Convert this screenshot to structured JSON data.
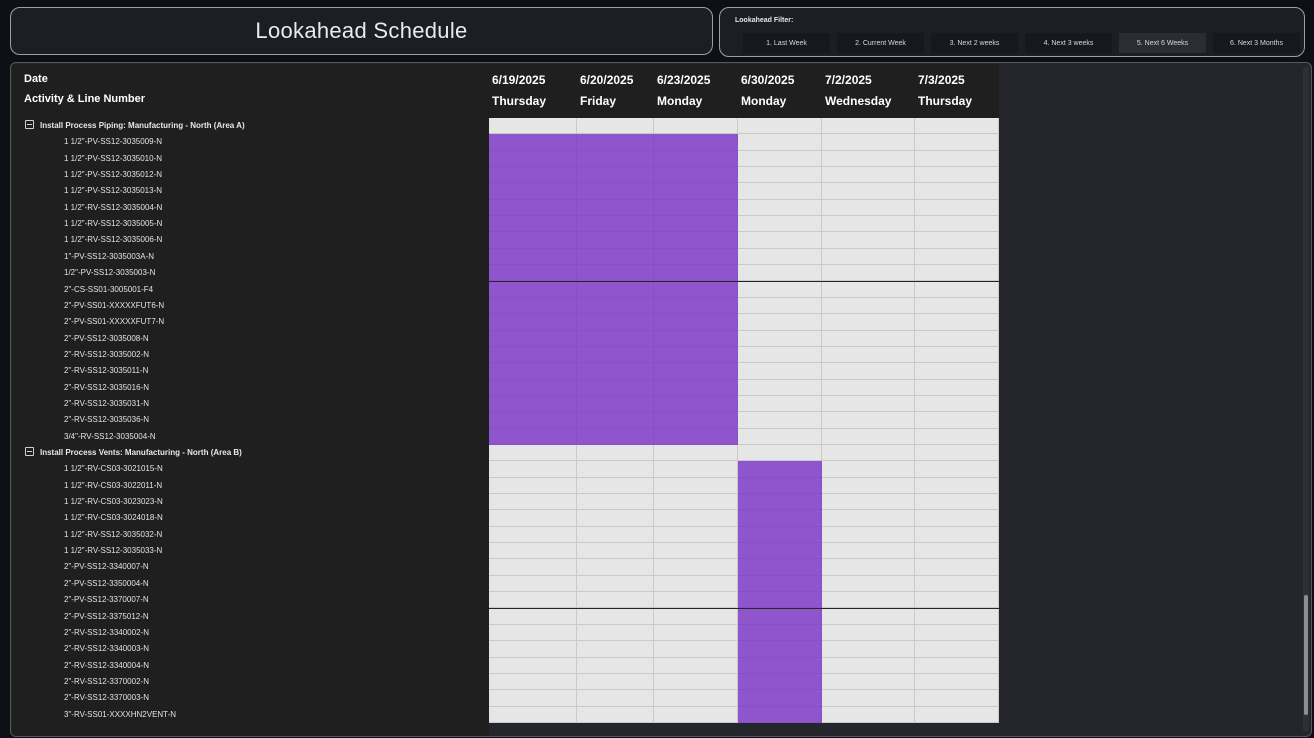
{
  "header": {
    "title": "Lookahead Schedule"
  },
  "filter": {
    "label": "Lookahead Filter:",
    "options": [
      "1. Last Week",
      "2. Current Week",
      "3. Next 2 weeks",
      "4. Next 3 weeks",
      "5. Next 6 Weeks",
      "6. Next 3 Months"
    ],
    "selected": "5. Next 6 Weeks"
  },
  "table": {
    "date_header": "Date",
    "activity_header": "Activity & Line Number",
    "columns": [
      {
        "date": "6/19/2025",
        "day": "Thursday"
      },
      {
        "date": "6/20/2025",
        "day": "Friday"
      },
      {
        "date": "6/23/2025",
        "day": "Monday"
      },
      {
        "date": "6/30/2025",
        "day": "Monday"
      },
      {
        "date": "7/2/2025",
        "day": "Wednesday"
      },
      {
        "date": "7/3/2025",
        "day": "Thursday"
      }
    ],
    "groups": [
      {
        "name": "Install Process Piping: Manufacturing - North (Area A)",
        "active_columns": [
          0,
          1,
          2
        ],
        "items": [
          "1 1/2\"-PV-SS12-3035009-N",
          "1 1/2\"-PV-SS12-3035010-N",
          "1 1/2\"-PV-SS12-3035012-N",
          "1 1/2\"-PV-SS12-3035013-N",
          "1 1/2\"-RV-SS12-3035004-N",
          "1 1/2\"-RV-SS12-3035005-N",
          "1 1/2\"-RV-SS12-3035006-N",
          "1\"-PV-SS12-3035003A-N",
          "1/2\"-PV-SS12-3035003-N",
          "2\"-CS-SS01-3005001-F4",
          "2\"-PV-SS01-XXXXXFUT6-N",
          "2\"-PV-SS01-XXXXXFUT7-N",
          "2\"-PV-SS12-3035008-N",
          "2\"-RV-SS12-3035002-N",
          "2\"-RV-SS12-3035011-N",
          "2\"-RV-SS12-3035016-N",
          "2\"-RV-SS12-3035031-N",
          "2\"-RV-SS12-3035036-N",
          "3/4\"-RV-SS12-3035004-N"
        ]
      },
      {
        "name": "Install Process Vents: Manufacturing - North (Area B)",
        "active_columns": [
          3
        ],
        "items": [
          "1 1/2\"-RV-CS03-3021015-N",
          "1 1/2\"-RV-CS03-3022011-N",
          "1 1/2\"-RV-CS03-3023023-N",
          "1 1/2\"-RV-CS03-3024018-N",
          "1 1/2\"-RV-SS12-3035032-N",
          "1 1/2\"-RV-SS12-3035033-N",
          "2\"-PV-SS12-3340007-N",
          "2\"-PV-SS12-3350004-N",
          "2\"-PV-SS12-3370007-N",
          "2\"-PV-SS12-3375012-N",
          "2\"-RV-SS12-3340002-N",
          "2\"-RV-SS12-3340003-N",
          "2\"-RV-SS12-3340004-N",
          "2\"-RV-SS12-3370002-N",
          "2\"-RV-SS12-3370003-N",
          "3\"-RV-SS01-XXXXHN2VENT-N"
        ]
      }
    ]
  },
  "colors": {
    "active_cell": "#8f55cc",
    "empty_cell": "#e6e6e6",
    "background": "#0e1015"
  }
}
